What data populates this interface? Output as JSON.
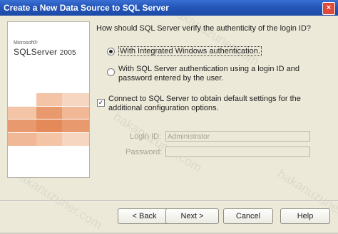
{
  "window": {
    "title": "Create a New Data Source to SQL Server",
    "close_glyph": "×"
  },
  "branding": {
    "microsoft": "Microsoft®",
    "product": "SQLServer",
    "year": "2005"
  },
  "question": "How should SQL Server verify the authenticity of the login ID?",
  "auth_options": [
    {
      "label": "With Integrated Windows authentication.",
      "selected": true
    },
    {
      "label": "With SQL Server authentication using a login ID and password entered by the user.",
      "selected": false
    }
  ],
  "connect_option": {
    "label": "Connect to SQL Server to obtain default settings for the additional configuration options.",
    "checked": true,
    "mark": "✓"
  },
  "login": {
    "label": "Login ID:",
    "value": "Administrator",
    "enabled": false
  },
  "password": {
    "label": "Password:",
    "value": "",
    "enabled": false
  },
  "buttons": {
    "back": "< Back",
    "next": "Next >",
    "cancel": "Cancel",
    "help": "Help"
  },
  "watermark": "hakanuzuner.com",
  "colors": {
    "title_bar": "#2456b8",
    "tile_dark": "#e89a6e",
    "tile_light": "#f3c4a6",
    "dialog_bg": "#ece9d8"
  }
}
